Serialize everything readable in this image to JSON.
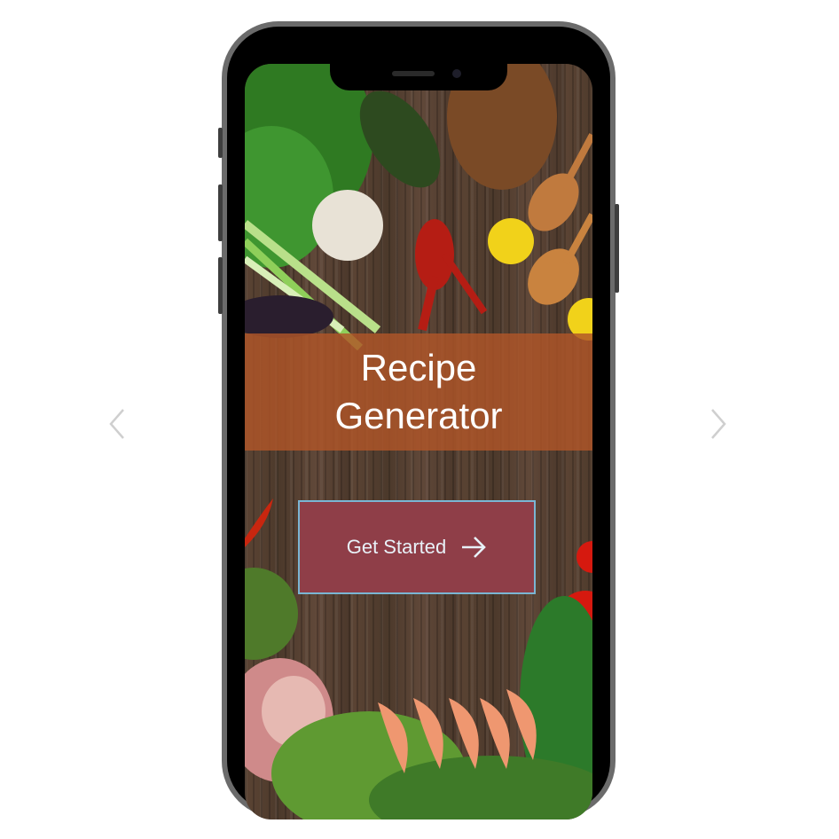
{
  "app": {
    "title_line1": "Recipe",
    "title_line2": "Generator"
  },
  "cta": {
    "label": "Get Started",
    "icon": "arrow-right-icon"
  },
  "carousel": {
    "prev_icon": "chevron-left-icon",
    "next_icon": "chevron-right-icon"
  },
  "colors": {
    "title_band": "#b05628",
    "cta_background": "#8f3e48",
    "cta_border": "#7ab6d4",
    "cta_text": "#e8f1f8",
    "wood_background": "#5b4434"
  }
}
